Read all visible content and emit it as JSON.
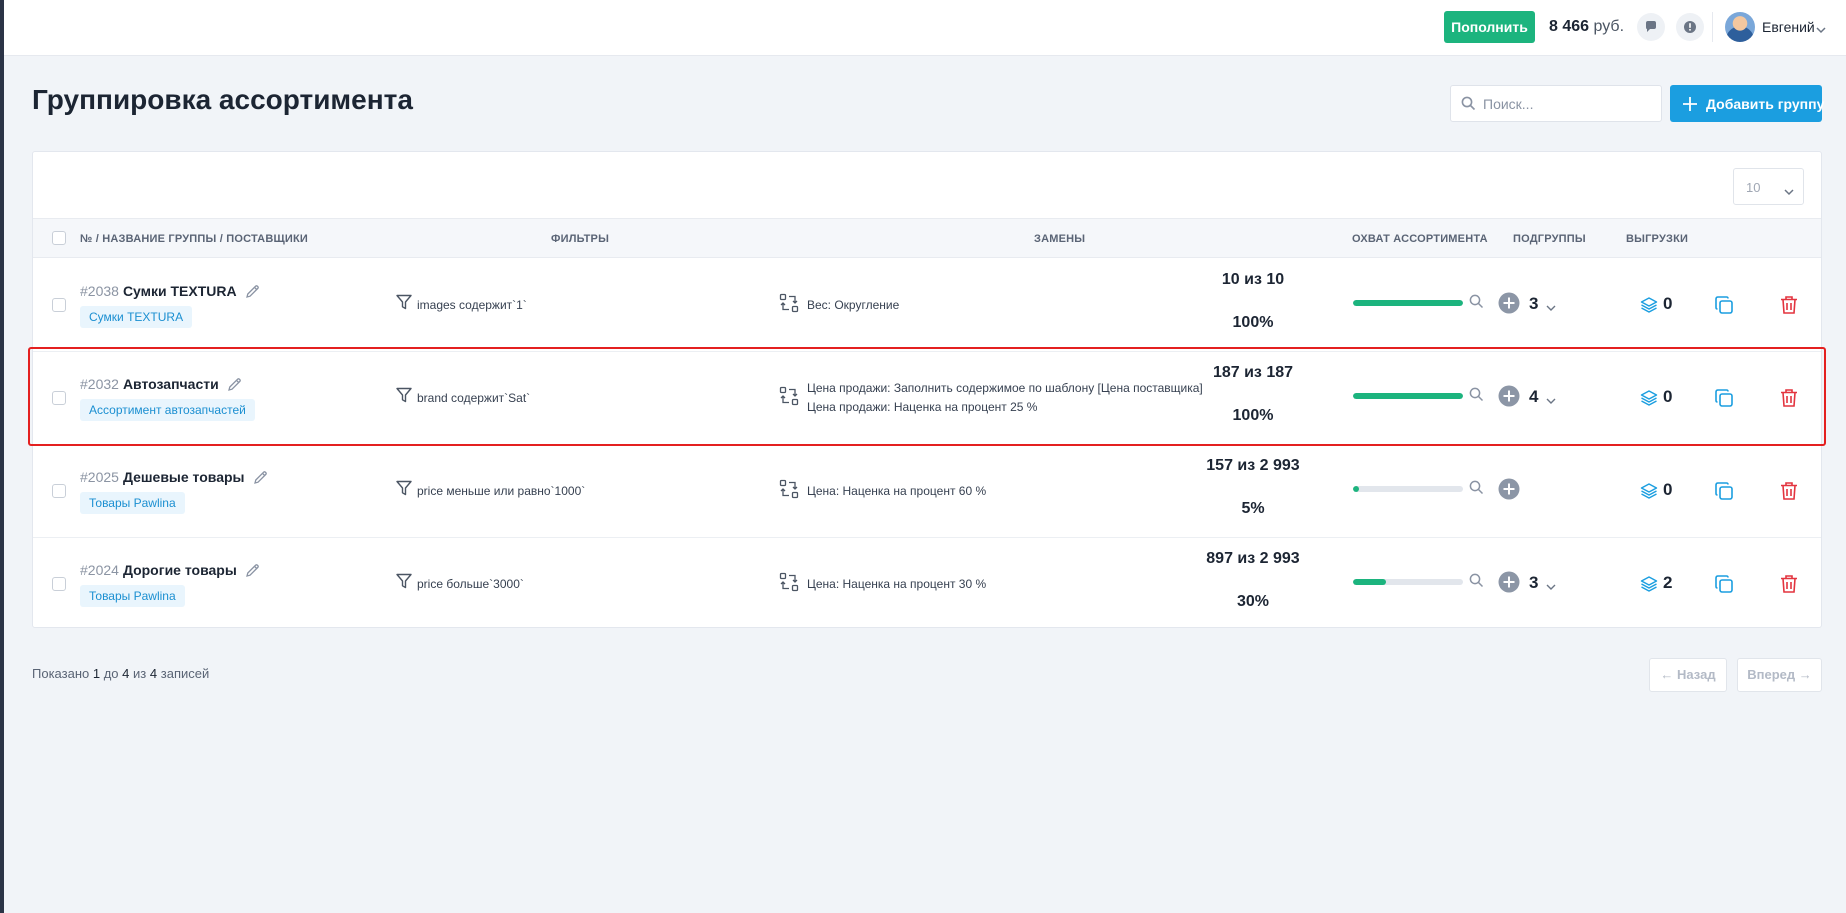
{
  "header": {
    "topup_label": "Пополнить",
    "balance_amount": "8 466",
    "balance_currency": "руб.",
    "user_name": "Евгений"
  },
  "page": {
    "title": "Группировка ассортимента",
    "search_placeholder": "Поиск...",
    "add_group_label": "Добавить группу",
    "per_page": "10"
  },
  "table": {
    "headers": {
      "name": "№ / НАЗВАНИЕ ГРУППЫ / ПОСТАВЩИКИ",
      "filters": "ФИЛЬТРЫ",
      "replacements": "ЗАМЕНЫ",
      "coverage": "ОХВАТ АССОРТИМЕНТА",
      "subgroups": "ПОДГРУППЫ",
      "exports": "ВЫГРУЗКИ"
    },
    "rows": [
      {
        "num": "#2038",
        "name": "Сумки TEXTURA",
        "supplier": "Сумки TEXTURA",
        "filter": "images содержит`1`",
        "replacements": [
          "Вес: Округление"
        ],
        "coverage_count": "10 из 10",
        "coverage_fraction": 1.0,
        "coverage_pct": "100%",
        "subgroups": "3",
        "exports": "0"
      },
      {
        "num": "#2032",
        "name": "Автозапчасти",
        "supplier": "Ассортимент автозапчастей",
        "filter": "brand содержит`Sat`",
        "replacements": [
          "Цена продажи: Заполнить содержимое по шаблону [Цена поставщика]",
          "Цена продажи: Наценка на процент 25 %"
        ],
        "coverage_count": "187 из 187",
        "coverage_fraction": 1.0,
        "coverage_pct": "100%",
        "subgroups": "4",
        "exports": "0"
      },
      {
        "num": "#2025",
        "name": "Дешевые товары",
        "supplier": "Товары Pawlina",
        "filter": "price меньше или равно`1000`",
        "replacements": [
          "Цена: Наценка на процент 60 %"
        ],
        "coverage_count": "157 из 2 993",
        "coverage_fraction": 0.05,
        "coverage_pct": "5%",
        "subgroups": "",
        "exports": "0"
      },
      {
        "num": "#2024",
        "name": "Дорогие товары",
        "supplier": "Товары Pawlina",
        "filter": "price больше`3000`",
        "replacements": [
          "Цена: Наценка на процент 30 %"
        ],
        "coverage_count": "897 из 2 993",
        "coverage_fraction": 0.3,
        "coverage_pct": "30%",
        "subgroups": "3",
        "exports": "2"
      }
    ]
  },
  "footer": {
    "shown_prefix": "Показано",
    "from": "1",
    "to_word": "до",
    "to": "4",
    "of_word": "из",
    "total": "4",
    "records_word": "записей",
    "prev_label": "← Назад",
    "next_label": "Вперед →"
  },
  "colors": {
    "accent_green": "#1cb47e",
    "accent_blue": "#1b9ee0",
    "danger_red": "#e42020",
    "highlight_border": "#e42020"
  },
  "icons": {
    "chat": "chat-icon",
    "alert": "alert-icon",
    "search": "search-icon",
    "filter": "filter-icon",
    "replace": "replace-icon",
    "export": "layers-icon",
    "copy": "copy-icon",
    "delete": "trash-icon"
  }
}
